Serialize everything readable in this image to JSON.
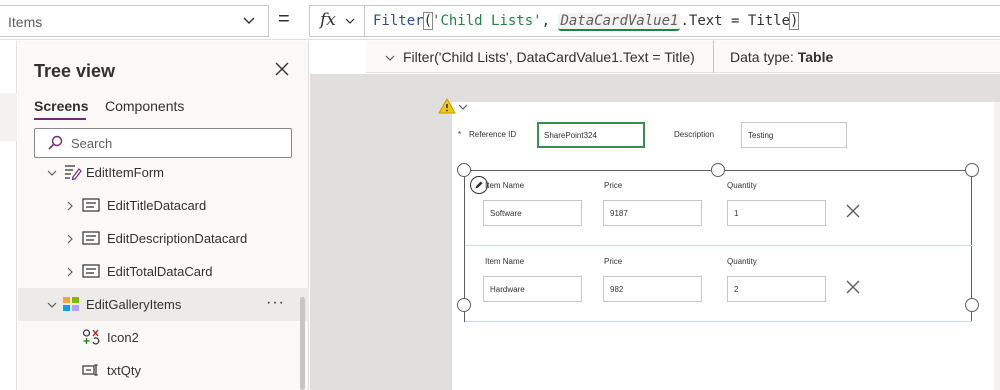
{
  "formula_bar": {
    "property": "Items",
    "equals": "=",
    "fx_label": "fx",
    "formula_tokens": {
      "fn": "Filter",
      "open": "(",
      "str": "'Child Lists'",
      "comma": ", ",
      "var": "DataCardValue1",
      "rest": ".Text = Title",
      "close": ")"
    }
  },
  "intellisense": {
    "expression": "Filter('Child Lists', DataCardValue1.Text = Title)",
    "data_type_label": "Data type:",
    "data_type_value": "Table"
  },
  "tree_view": {
    "title": "Tree view",
    "tabs": [
      "Screens",
      "Components"
    ],
    "search_placeholder": "Search",
    "items": [
      {
        "label": "EditItemForm"
      },
      {
        "label": "EditTitleDatacard"
      },
      {
        "label": "EditDescriptionDatacard"
      },
      {
        "label": "EditTotalDataCard"
      },
      {
        "label": "EditGalleryItems"
      },
      {
        "label": "Icon2"
      },
      {
        "label": "txtQty"
      }
    ],
    "more_label": "···"
  },
  "canvas": {
    "form": {
      "ref_label": "Reference ID",
      "ref_value": "SharePoint324",
      "desc_label": "Description",
      "desc_value": "Testing",
      "required_mark": "*"
    },
    "gallery": {
      "columns": [
        "Item Name",
        "Price",
        "Quantity"
      ],
      "rows": [
        {
          "item": "Software",
          "price": "9187",
          "qty": "1"
        },
        {
          "item": "Hardware",
          "price": "982",
          "qty": "2"
        }
      ]
    }
  },
  "colors": {
    "accent_purple": "#742774",
    "focus_green": "#3a8f4f",
    "warning_yellow": "#f2c811"
  },
  "icons": [
    "chevron-down-icon",
    "fx-icon",
    "close-icon",
    "search-icon",
    "form-icon",
    "datacard-icon",
    "gallery-icon",
    "icon-control-icon",
    "textinput-icon",
    "warning-icon",
    "edit-pencil-icon",
    "delete-x-icon"
  ]
}
